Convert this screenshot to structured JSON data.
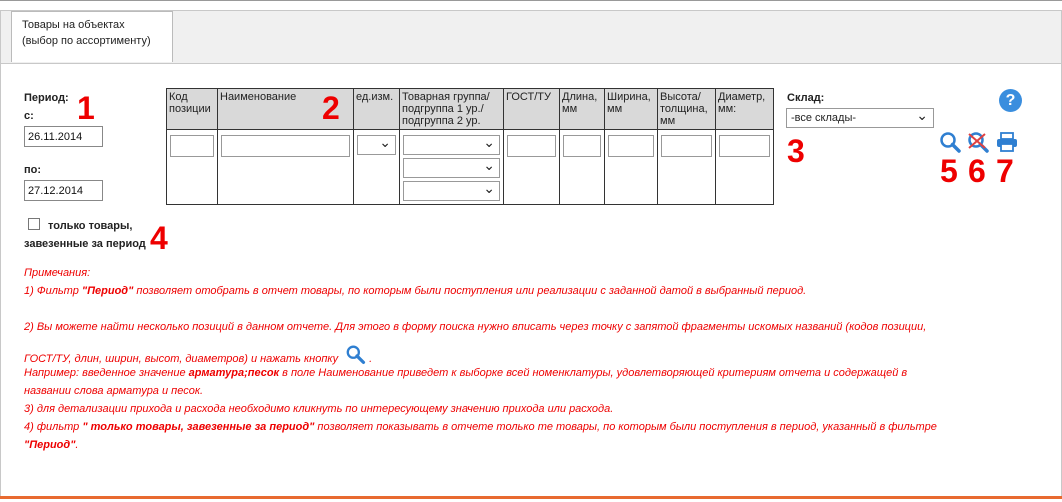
{
  "tab": {
    "line1": "Товары на объектах",
    "line2": "(выбор по ассортименту)"
  },
  "period": {
    "label": "Период:",
    "from_label": "с:",
    "from_value": "26.11.2014",
    "to_label": "по:",
    "to_value": "27.12.2014"
  },
  "table": {
    "headers": [
      "Код позиции",
      "Наименование",
      "ед.изм.",
      "Товарная группа/ подгруппа 1 ур./ подгруппа 2 ур.",
      "ГОСТ/ТУ",
      "Длина, мм",
      "Ширина, мм",
      "Высота/ толщина, мм",
      "Диаметр, мм:"
    ]
  },
  "warehouse": {
    "label": "Склад:",
    "value": "-все склады-"
  },
  "only_goods": {
    "line1": "только товары,",
    "line2": "завезенные за период"
  },
  "markers": [
    "1",
    "2",
    "3",
    "4",
    "5",
    "6",
    "7"
  ],
  "icons": {
    "search": "search-icon",
    "clear": "clear-search-icon",
    "print": "print-icon",
    "help": "help-icon"
  },
  "colors": {
    "accent": "#e00000",
    "help": "#3a8ede",
    "bottom_border": "#e86a30"
  },
  "notes": {
    "title": "Примечания:",
    "n1_pre": "1) Фильтр ",
    "n1_bold": "\"Период\"",
    "n1_post": " позволяет отобрать в отчет товары, по которым были поступления или реализации с заданной датой в выбранный период.",
    "n2_line1": "2) Вы можете найти несколько позиций в данном отчете. Для этого в форму поиска нужно вписать через точку с запятой фрагменты искомых названий (кодов позиции,",
    "n2_line2": "ГОСТ/ТУ, длин, ширин, высот, диаметров) и нажать кнопку",
    "example_pre": "Например: введенное значение ",
    "example_bold": "арматура;песок",
    "example_post": " в поле Наименование приведет к выборке всей номенклатуры, удовлетворяющей критериям отчета и содержащей в",
    "example_line2": "названии слова арматура и песок.",
    "n3": "3) для детализации прихода и расхода необходимо кликнуть по интересующему значению прихода или расхода.",
    "n4_pre": "4) фильтр ",
    "n4_bold": "\" только товары, завезенные за период\"",
    "n4_post": " позволяет показывать в отчете только те товары, по которым были поступления в период, указанный в фильтре",
    "n4_line2_bold": "\"Период\"",
    "n4_line2_post": "."
  }
}
